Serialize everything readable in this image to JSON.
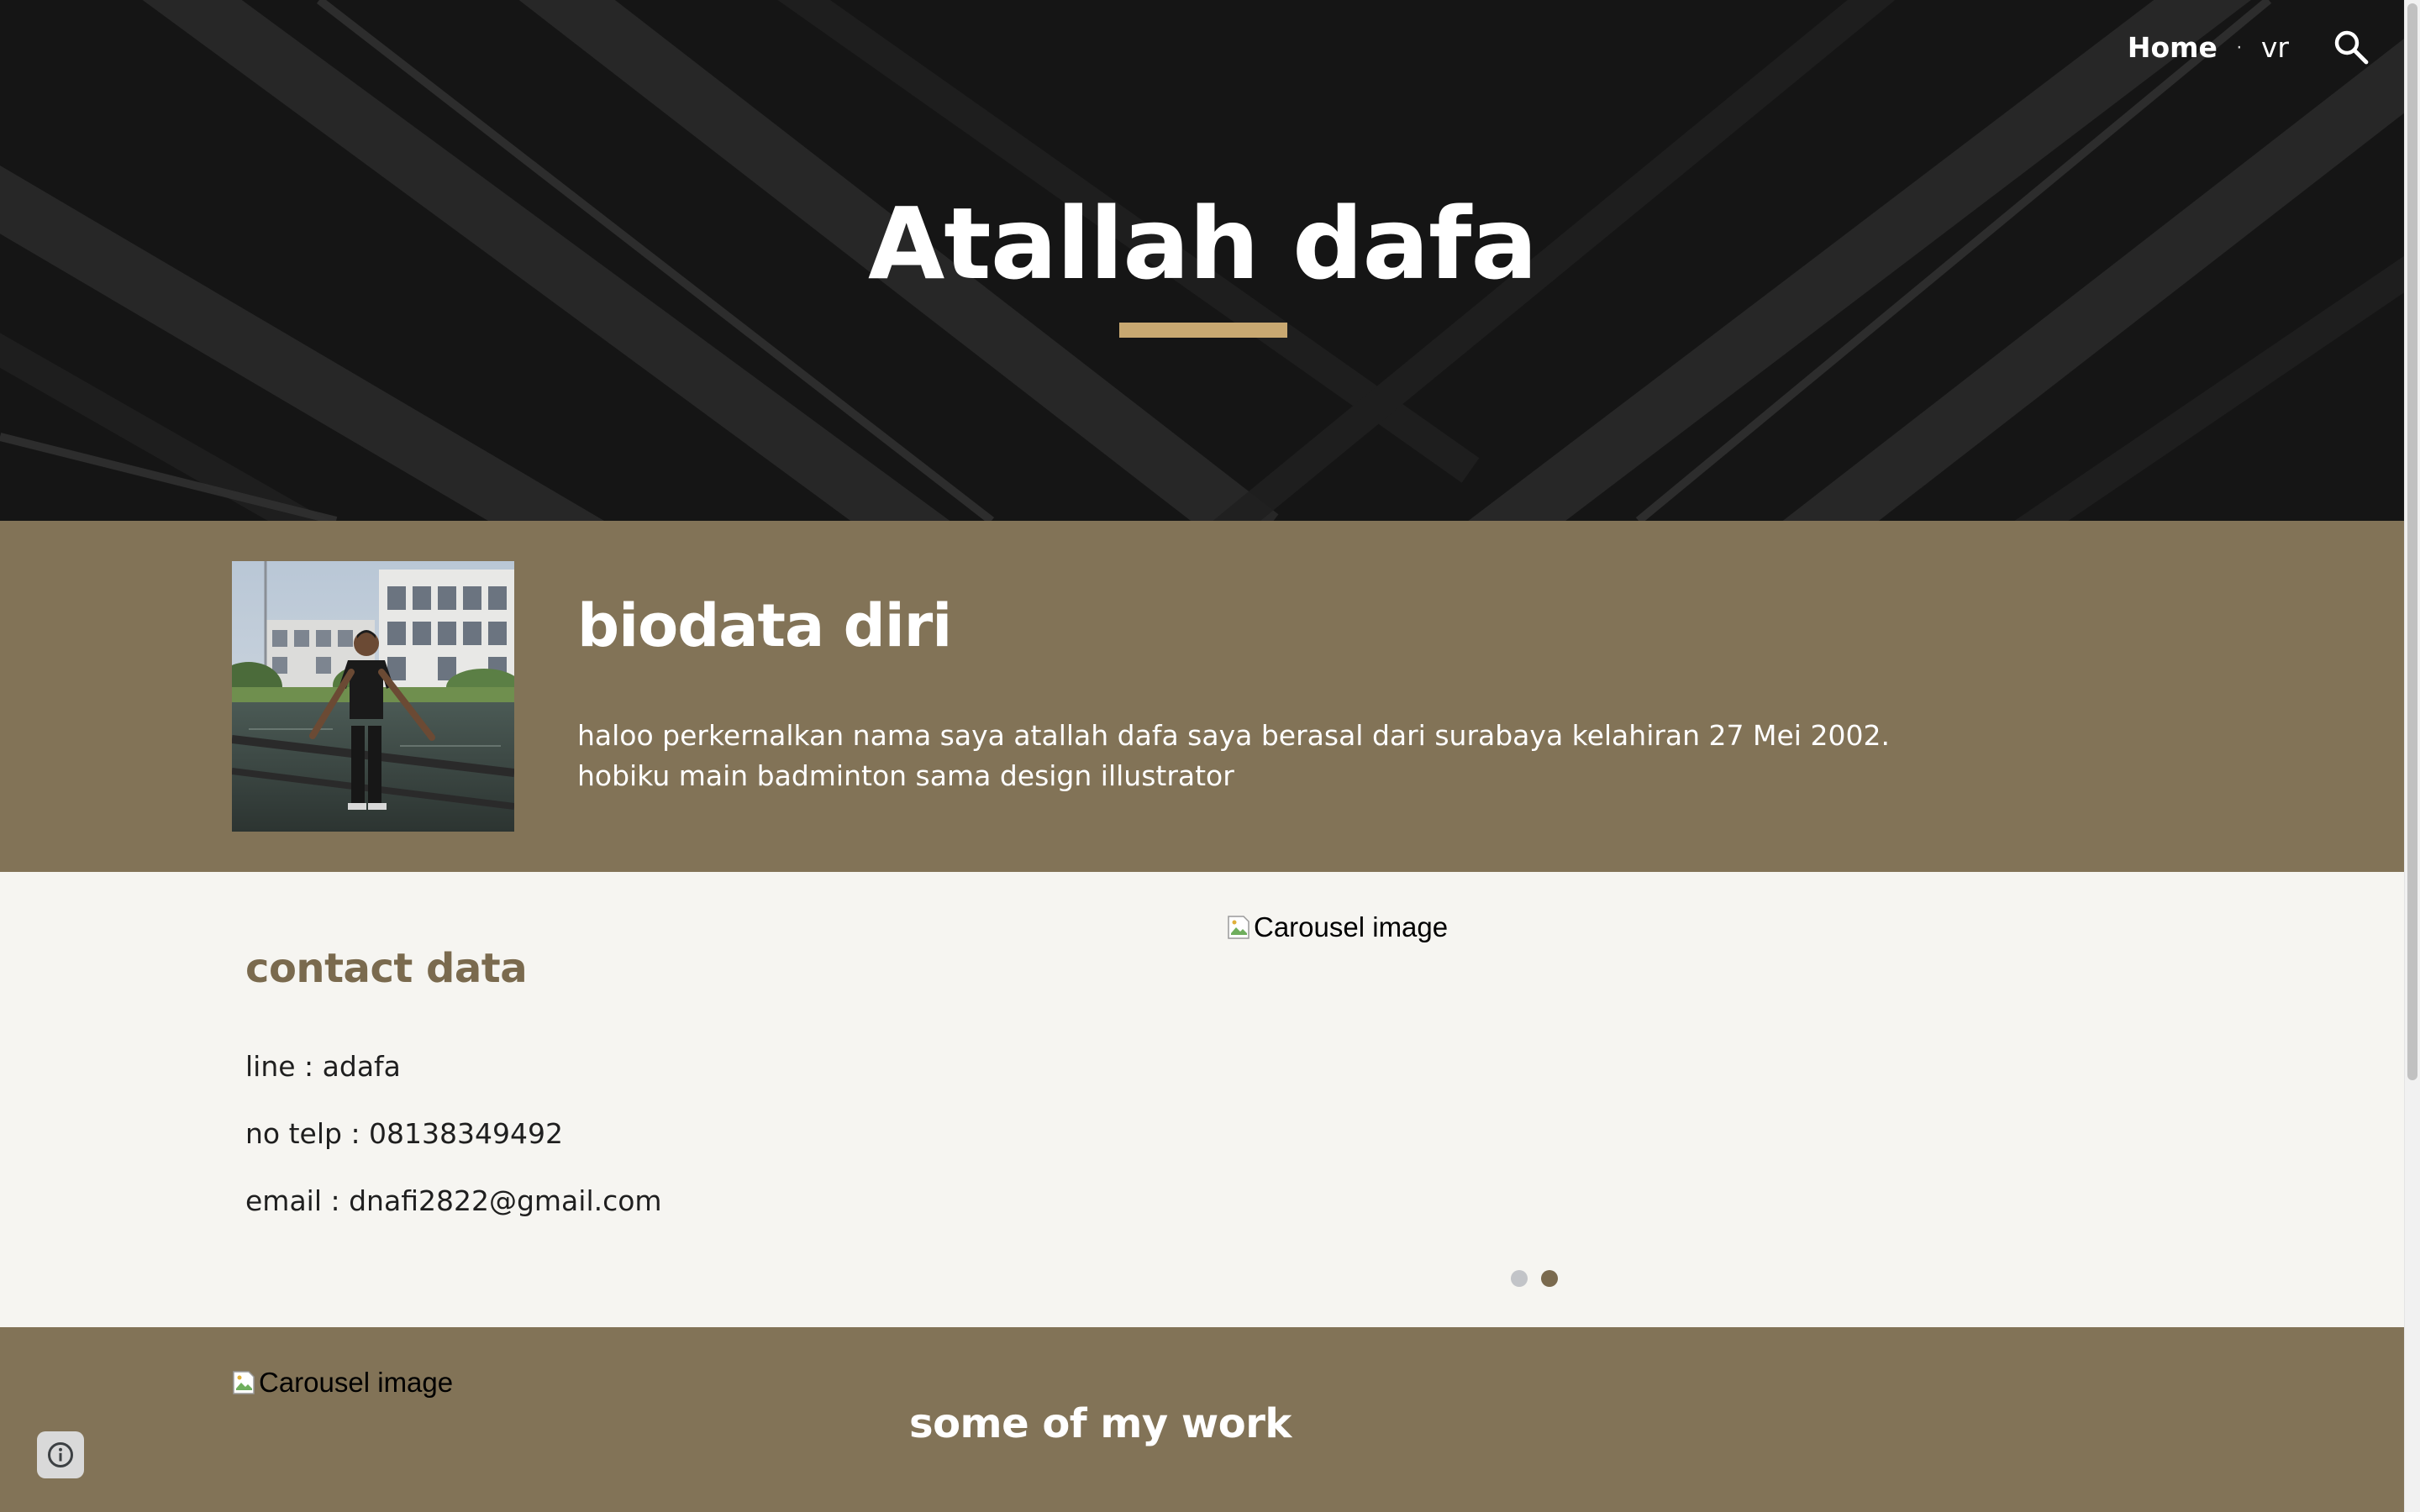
{
  "header": {
    "site_title": "Atallah dafa",
    "nav": [
      {
        "label": "Home",
        "active": true
      },
      {
        "label": "vr",
        "active": false
      }
    ],
    "separator": "·",
    "search_icon": "search-icon",
    "accent_color": "#c8a871"
  },
  "biodata": {
    "heading": "biodata diri",
    "text": "haloo perkernalkan nama saya atallah dafa saya berasal dari surabaya kelahiran 27 Mei 2002. hobiku main badminton sama design illustrator",
    "background_color": "#827357"
  },
  "contact": {
    "heading": "contact data",
    "lines": [
      "line : adafa",
      "no telp : 08138349492",
      "email : dnafi2822@gmail.com"
    ],
    "carousel_alt": "Carousel image",
    "carousel_dots": 2,
    "carousel_active_index": 1
  },
  "work": {
    "heading": "some of my work",
    "carousel_alt": "Carousel image",
    "text": ""
  },
  "info_button_icon": "info-icon"
}
